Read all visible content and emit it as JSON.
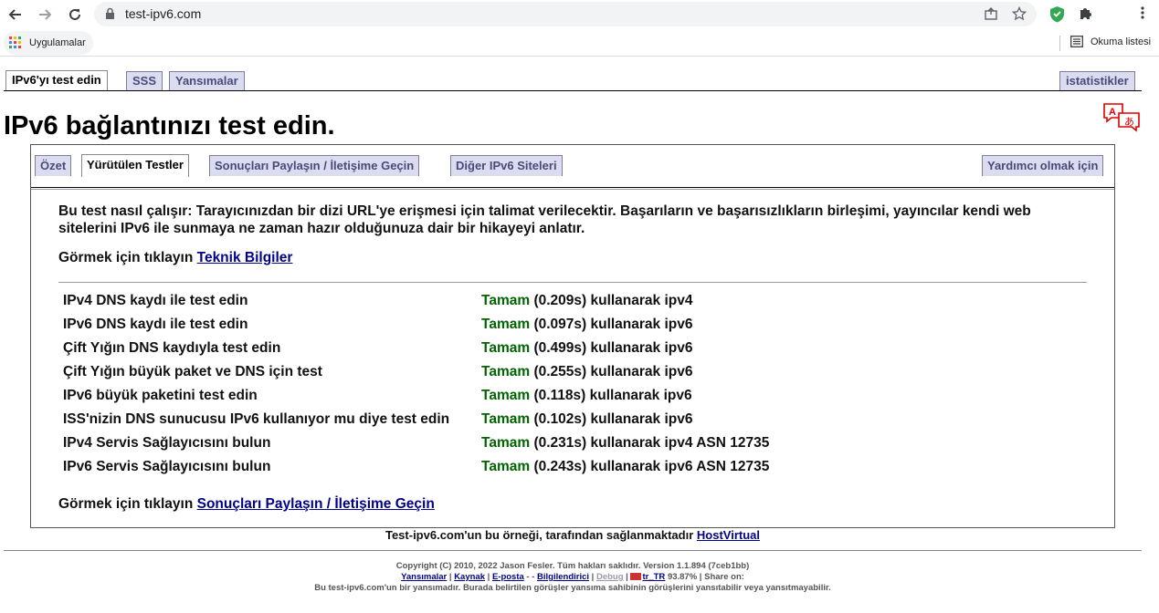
{
  "browser": {
    "url": "test-ipv6.com",
    "bookmarks": {
      "apps_label": "Uygulamalar",
      "reading_list_label": "Okuma listesi"
    }
  },
  "top_tabs": {
    "test": "IPv6'yı test edin",
    "faq": "SSS",
    "mirrors": "Yansımalar",
    "stats": "istatistikler"
  },
  "page_title": "IPv6 bağlantınızı test edin.",
  "inner_tabs": {
    "summary": "Özet",
    "tests_run": "Yürütülen Testler",
    "share": "Sonuçları Paylaşın / İletişime Geçin",
    "other_sites": "Diğer IPv6 Siteleri",
    "help": "Yardımcı olmak için"
  },
  "description": "Bu test nasıl çalışır: Tarayıcınızdan bir dizi URL'ye erişmesi için talimat verilecektir. Başarıların ve başarısızlıkların birleşimi, yayıncılar kendi web sitelerini IPv6 ile sunmaya ne zaman hazır olduğunuza dair bir hikayeyi anlatır.",
  "tech_info": {
    "prefix": "Görmek için tıklayın",
    "link": "Teknik Bilgiler"
  },
  "tests": [
    {
      "name": "IPv4 DNS kaydı ile test edin",
      "status": "Tamam",
      "detail": "(0.209s) kullanarak ipv4"
    },
    {
      "name": "IPv6 DNS kaydı ile test edin",
      "status": "Tamam",
      "detail": "(0.097s) kullanarak ipv6"
    },
    {
      "name": "Çift Yığın DNS kaydıyla test edin",
      "status": "Tamam",
      "detail": "(0.499s) kullanarak ipv6"
    },
    {
      "name": "Çift Yığın büyük paket ve DNS için test",
      "status": "Tamam",
      "detail": "(0.255s) kullanarak ipv6"
    },
    {
      "name": "IPv6 büyük paketini test edin",
      "status": "Tamam",
      "detail": "(0.118s) kullanarak ipv6"
    },
    {
      "name": "ISS'nizin DNS sunucusu IPv6 kullanıyor mu diye test edin",
      "status": "Tamam",
      "detail": "(0.102s) kullanarak ipv6"
    },
    {
      "name": "IPv4 Servis Sağlayıcısını bulun",
      "status": "Tamam",
      "detail": "(0.231s) kullanarak ipv4 ASN 12735"
    },
    {
      "name": "IPv6 Servis Sağlayıcısını bulun",
      "status": "Tamam",
      "detail": "(0.243s) kullanarak ipv6 ASN 12735"
    }
  ],
  "share_info": {
    "prefix": "Görmek için tıklayın",
    "link": "Sonuçları Paylaşın / İletişime Geçin"
  },
  "hosted": {
    "text": "Test-ipv6.com'un bu örneği, tarafından sağlanmaktadır",
    "link": "HostVirtual"
  },
  "footer": {
    "copyright": "Copyright (C) 2010, 2022 Jason Fesler. Tüm hakları saklıdır. Version 1.1.894 (7ceb1bb)",
    "links": {
      "mirrors": "Yansımalar",
      "source": "Kaynak",
      "email": "E-posta",
      "translator": "Bilgilendirici",
      "debug": "Debug",
      "locale": "tr_TR",
      "percent": "93.87%",
      "share": "Share on:"
    },
    "disclaimer": "Bu test-ipv6.com'un bir yansımadır. Burada belirtilen görüşler yansıma sahibinin görüşlerini yansıtabilir veya yansıtmayabilir."
  },
  "colors": {
    "ok_green": "#006400",
    "link_blue": "#00008b",
    "tab_bg": "#dcdcf0"
  }
}
